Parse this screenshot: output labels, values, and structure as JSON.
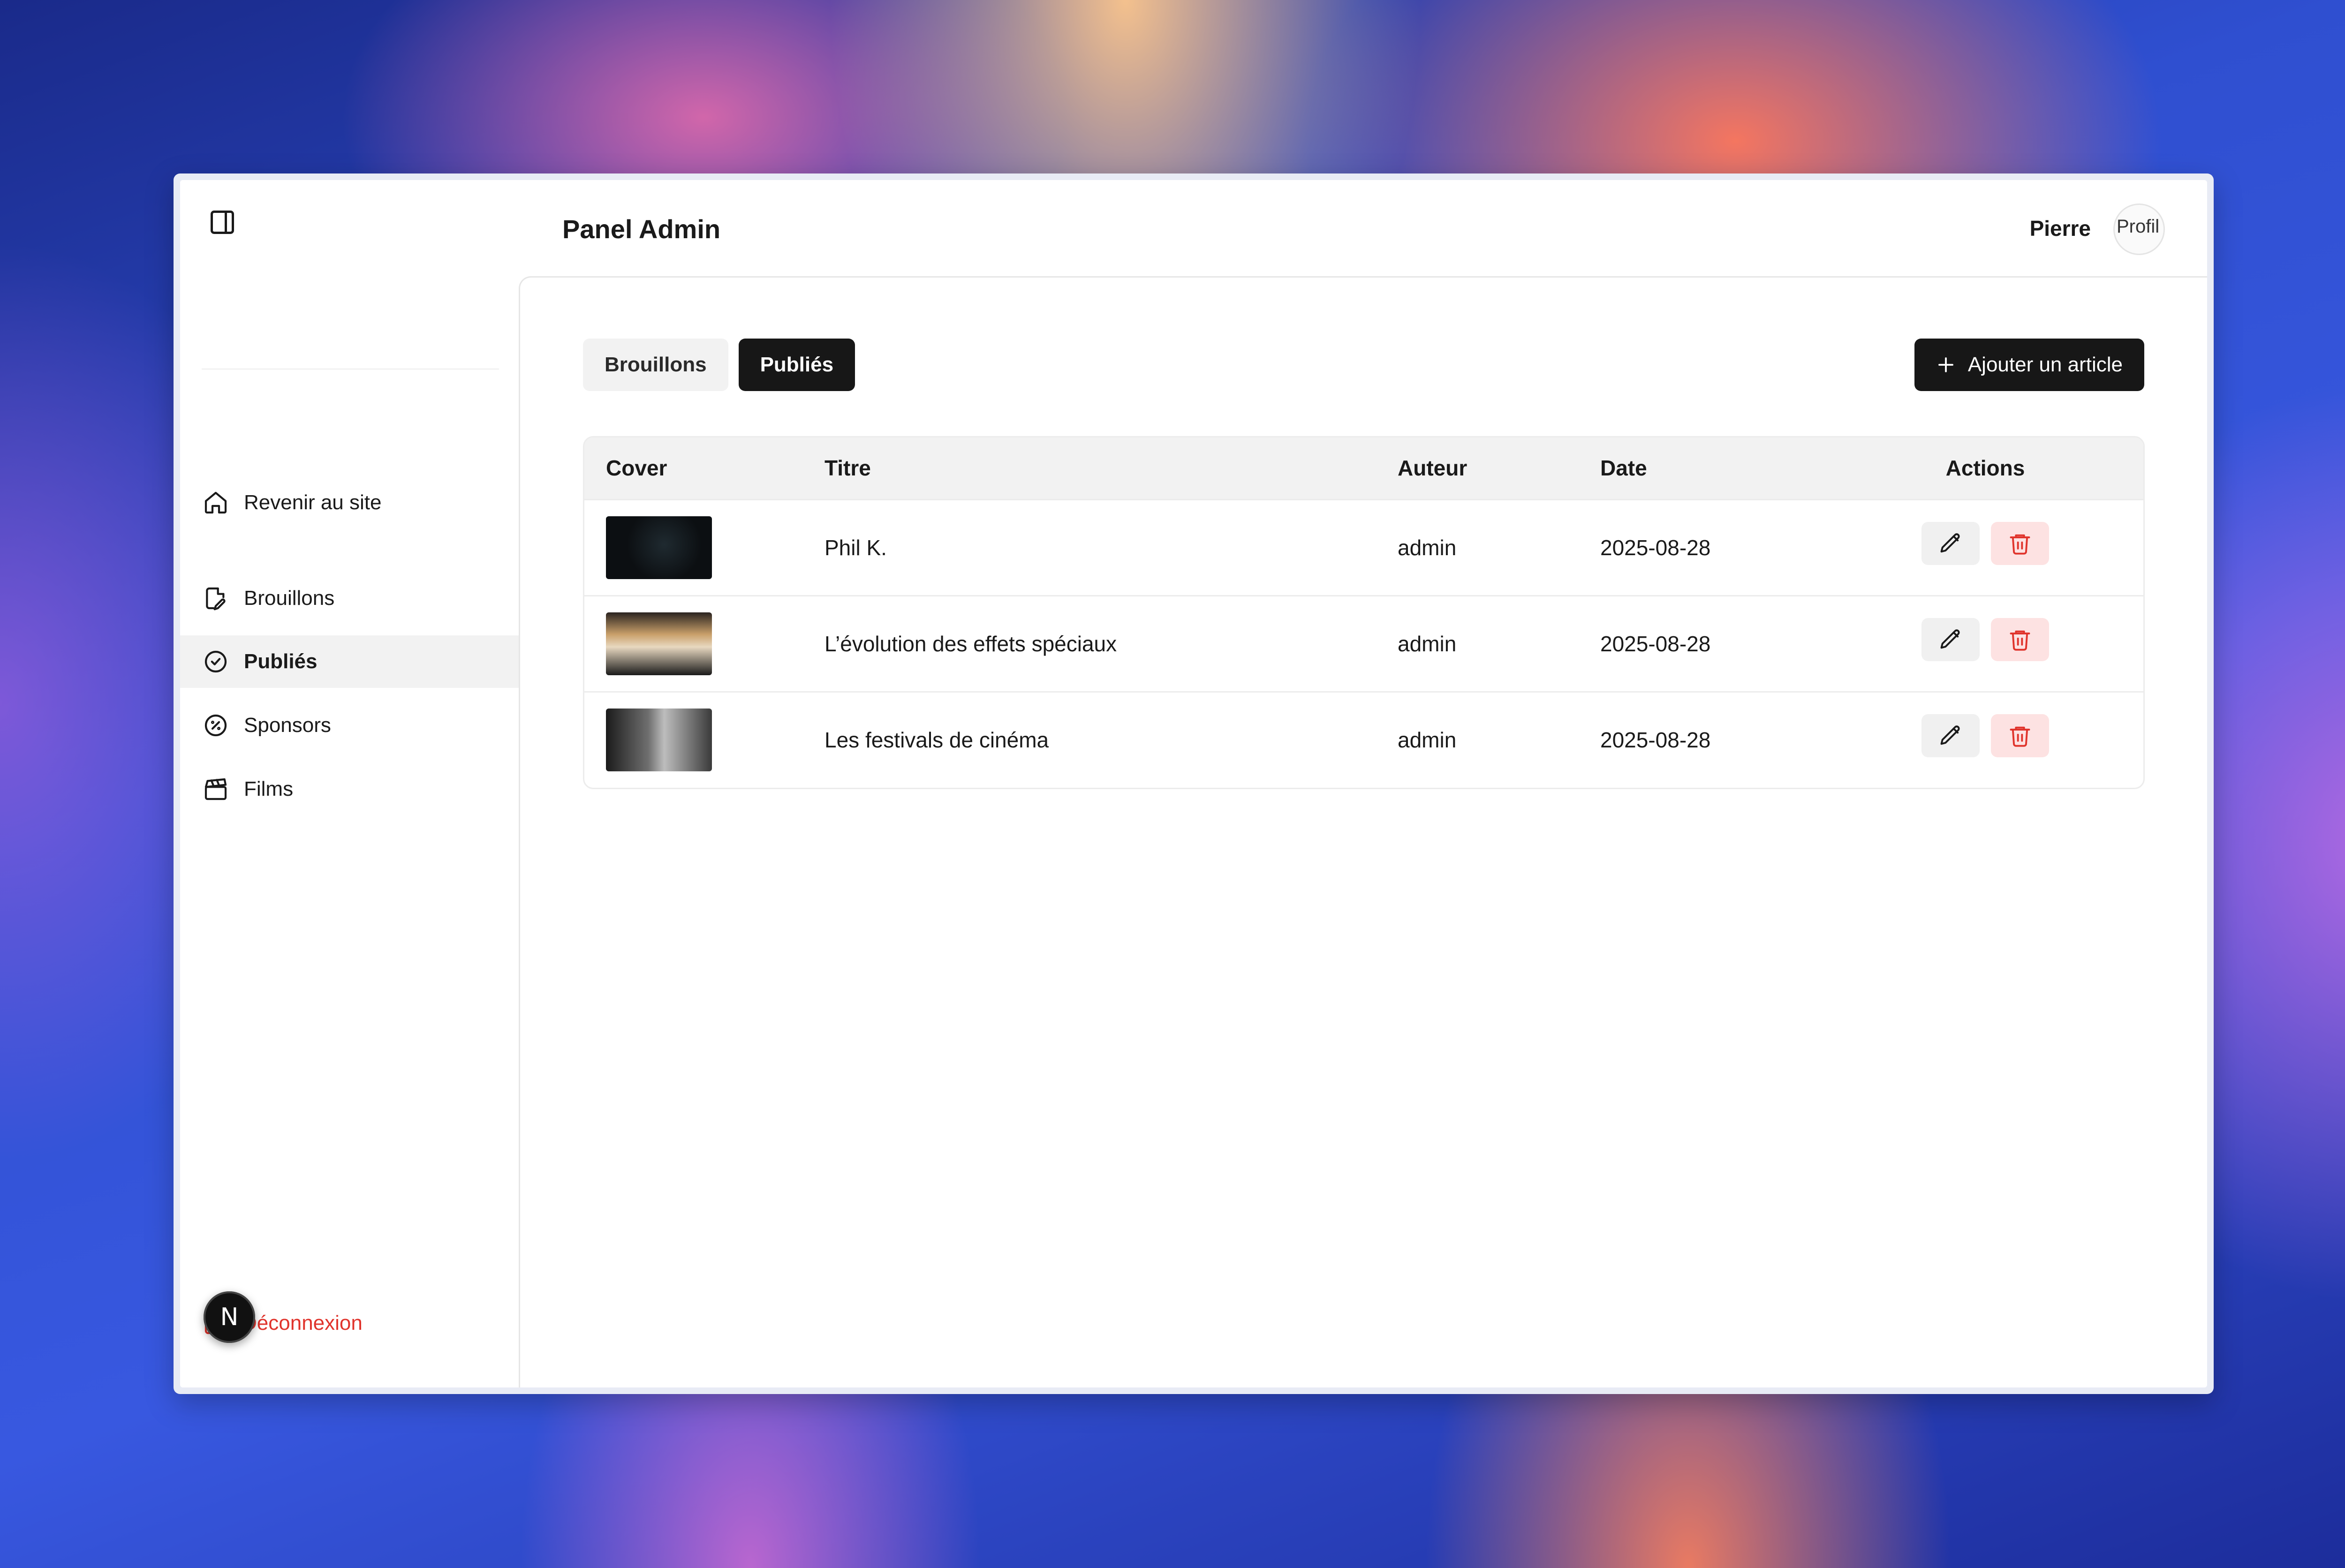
{
  "header": {
    "title": "Panel Admin",
    "user_name": "Pierre",
    "avatar_alt": "Profil"
  },
  "sidebar": {
    "toggle_icon": "sidebar-toggle-icon",
    "items": [
      {
        "label": "Revenir au site",
        "icon": "home-icon"
      },
      {
        "label": "Brouillons",
        "icon": "file-edit-icon"
      },
      {
        "label": "Publiés",
        "icon": "circle-check-icon",
        "active": true
      },
      {
        "label": "Sponsors",
        "icon": "badge-percent-icon"
      },
      {
        "label": "Films",
        "icon": "clapperboard-icon"
      }
    ],
    "logout_label": "Déconnexion",
    "next_badge": "N"
  },
  "main": {
    "tabs": [
      {
        "label": "Brouillons",
        "active": false
      },
      {
        "label": "Publiés",
        "active": true
      }
    ],
    "add_button_label": "Ajouter un article",
    "table": {
      "columns": [
        "Cover",
        "Titre",
        "Auteur",
        "Date",
        "Actions"
      ],
      "rows": [
        {
          "title": "Phil K.",
          "author": "admin",
          "date": "2025-08-28"
        },
        {
          "title": "L’évolution des effets spéciaux",
          "author": "admin",
          "date": "2025-08-28"
        },
        {
          "title": "Les festivals de cinéma",
          "author": "admin",
          "date": "2025-08-28"
        }
      ]
    }
  },
  "colors": {
    "primary": "#171717",
    "danger": "#e0342c",
    "danger_bg": "#fde2e2",
    "active_bg": "#f2f2f2"
  }
}
